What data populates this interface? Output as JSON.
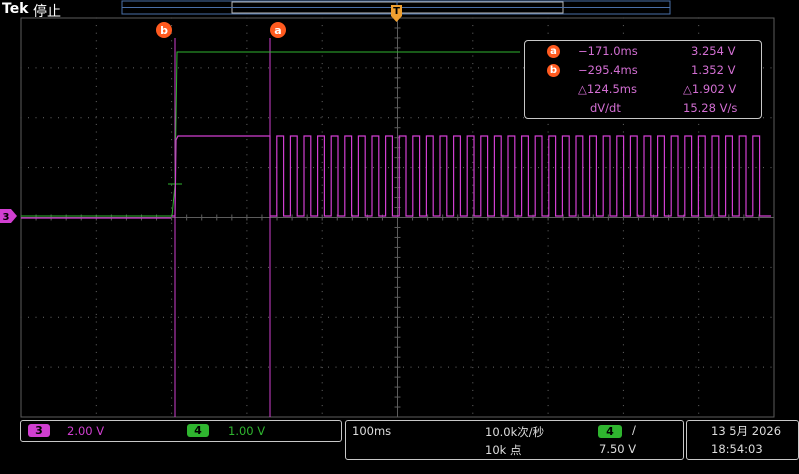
{
  "header": {
    "brand": "Tek",
    "status": "停止"
  },
  "cursor_labels": {
    "a": "a",
    "b": "b"
  },
  "channel_marker": "3",
  "cursor_readout": {
    "a_time": "−171.0ms",
    "a_volt": "3.254 V",
    "b_time": "−295.4ms",
    "b_volt": "1.352 V",
    "delta_time": "△124.5ms",
    "delta_volt": "△1.902 V",
    "dvdt_label": "dV/dt",
    "dvdt_value": "15.28 V/s"
  },
  "bottom": {
    "ch3_num": "3",
    "ch3_scale": "2.00 V",
    "ch4_num": "4",
    "ch4_scale": "1.00 V",
    "timebase": "100ms",
    "sample_rate": "10.0k次/秒",
    "record_length": "10k 点",
    "trigger_source": "4",
    "trigger_slope": "/",
    "trigger_level": "7.50 V",
    "date": "13 5月 2026",
    "time": "18:54:03"
  },
  "colors": {
    "ch3": "#d13fd1",
    "ch4": "#2fb52f",
    "cursor": "#ff5a1f",
    "trigger": "#f0a030"
  }
}
